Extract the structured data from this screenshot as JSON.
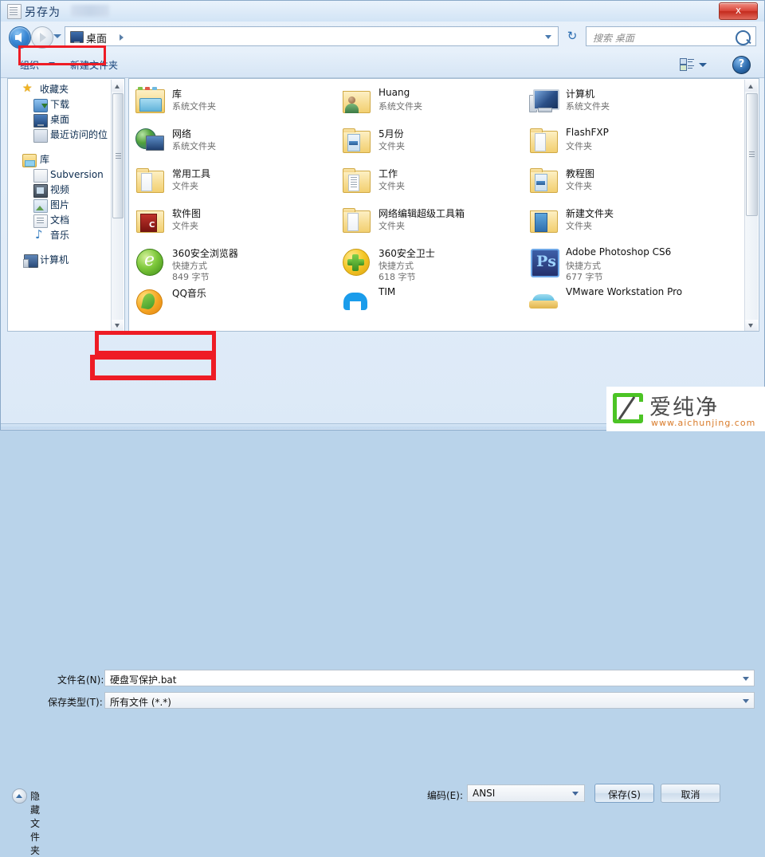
{
  "window": {
    "title": "另存为",
    "close_label": "x",
    "icon": "notepad-icon"
  },
  "address_bar": {
    "crumb": "桌面",
    "refresh_label": "↻"
  },
  "search": {
    "placeholder": "搜索 桌面"
  },
  "command_bar": {
    "organize": "组织",
    "new_folder": "新建文件夹",
    "help_label": "?"
  },
  "sidebar": {
    "groups": [
      {
        "label": "收藏夹",
        "icon": "star-icon",
        "items": [
          {
            "label": "下载",
            "icon": "download-icon",
            "selected": false
          },
          {
            "label": "桌面",
            "icon": "desktop-icon",
            "selected": true
          },
          {
            "label": "最近访问的位",
            "icon": "recent-icon",
            "selected": false
          }
        ]
      },
      {
        "label": "库",
        "icon": "library-icon",
        "items": [
          {
            "label": "Subversion",
            "icon": "subversion-icon",
            "selected": false
          },
          {
            "label": "视频",
            "icon": "video-icon",
            "selected": false
          },
          {
            "label": "图片",
            "icon": "picture-icon",
            "selected": false
          },
          {
            "label": "文档",
            "icon": "document-icon",
            "selected": false
          },
          {
            "label": "音乐",
            "icon": "music-icon",
            "selected": false
          }
        ]
      },
      {
        "label": "计算机",
        "icon": "computer-icon",
        "items": []
      }
    ]
  },
  "file_list": {
    "columns": [
      [
        {
          "name": "库",
          "type": "系统文件夹",
          "size": "",
          "icon": "library-folder-icon"
        },
        {
          "name": "网络",
          "type": "系统文件夹",
          "size": "",
          "icon": "network-icon"
        },
        {
          "name": "常用工具",
          "type": "文件夹",
          "size": "",
          "icon": "folder-icon"
        },
        {
          "name": "软件图",
          "type": "文件夹",
          "size": "",
          "icon": "soft-folder-icon"
        },
        {
          "name": "360安全浏览器",
          "type": "快捷方式",
          "size": "849 字节",
          "icon": "360-browser-icon"
        },
        {
          "name": "QQ音乐",
          "type": "",
          "size": "",
          "icon": "qq-music-icon"
        }
      ],
      [
        {
          "name": "Huang",
          "type": "系统文件夹",
          "size": "",
          "icon": "user-folder-icon"
        },
        {
          "name": "5月份",
          "type": "文件夹",
          "size": "",
          "icon": "cap-folder-icon"
        },
        {
          "name": "工作",
          "type": "文件夹",
          "size": "",
          "icon": "line-folder-icon"
        },
        {
          "name": "网络编辑超级工具箱",
          "type": "文件夹",
          "size": "",
          "icon": "folder-icon"
        },
        {
          "name": "360安全卫士",
          "type": "快捷方式",
          "size": "618 字节",
          "icon": "360-safe-icon"
        },
        {
          "name": "TIM",
          "type": "",
          "size": "",
          "icon": "tim-icon"
        }
      ],
      [
        {
          "name": "计算机",
          "type": "系统文件夹",
          "size": "",
          "icon": "computer-big-icon"
        },
        {
          "name": "FlashFXP",
          "type": "文件夹",
          "size": "",
          "icon": "folder-icon"
        },
        {
          "name": "教程图",
          "type": "文件夹",
          "size": "",
          "icon": "cap-folder-icon"
        },
        {
          "name": "新建文件夹",
          "type": "文件夹",
          "size": "",
          "icon": "blue-folder-icon"
        },
        {
          "name": "Adobe Photoshop CS6",
          "type": "快捷方式",
          "size": "677 字节",
          "icon": "photoshop-icon"
        },
        {
          "name": "VMware Workstation Pro",
          "type": "",
          "size": "",
          "icon": "vmware-icon"
        }
      ]
    ]
  },
  "form": {
    "filename_label": "文件名(N):",
    "filename_value": "硬盘写保护.bat",
    "filetype_label": "保存类型(T):",
    "filetype_value": "所有文件  (*.*)"
  },
  "footer": {
    "hide_folders": "隐藏文件夹",
    "encoding_label": "编码(E):",
    "encoding_value": "ANSI",
    "save_label": "保存(S)",
    "cancel_label": "取消"
  },
  "watermark": {
    "brand": "爱纯净",
    "url": "www.aichunjing.com"
  },
  "colors": {
    "highlight": "#ee1c25",
    "accent": "#2a6cb0",
    "brand_green": "#4cc425"
  }
}
